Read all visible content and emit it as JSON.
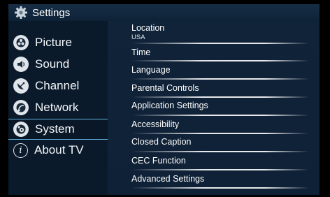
{
  "header": {
    "title": "Settings",
    "icon": "gear-icon"
  },
  "sidebar": {
    "items": [
      {
        "label": "Picture",
        "icon": "picture-icon",
        "selected": false
      },
      {
        "label": "Sound",
        "icon": "speaker-icon",
        "selected": false
      },
      {
        "label": "Channel",
        "icon": "satellite-dish-icon",
        "selected": false
      },
      {
        "label": "Network",
        "icon": "network-icon",
        "selected": false
      },
      {
        "label": "System",
        "icon": "system-icon",
        "selected": true
      },
      {
        "label": "About TV",
        "icon": "info-icon",
        "selected": false
      }
    ]
  },
  "panel": {
    "items": [
      {
        "label": "Location",
        "value": "USA"
      },
      {
        "label": "Time"
      },
      {
        "label": "Language"
      },
      {
        "label": "Parental Controls"
      },
      {
        "label": "Application Settings"
      },
      {
        "label": "Accessibility"
      },
      {
        "label": "Closed Caption"
      },
      {
        "label": "CEC Function"
      },
      {
        "label": "Advanced Settings"
      }
    ]
  },
  "colors": {
    "header_bg": "#172e46",
    "sidebar_bg": "#0b1a2a",
    "panel_bg": "#102339",
    "selection_border": "#5fb2dd"
  }
}
